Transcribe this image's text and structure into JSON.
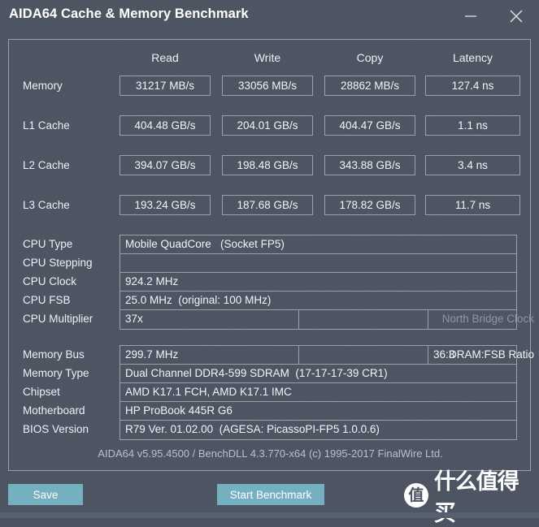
{
  "window": {
    "title": "AIDA64 Cache & Memory Benchmark",
    "minimize_label": "minimize",
    "close_label": "close"
  },
  "bench": {
    "columns": [
      "Read",
      "Write",
      "Copy",
      "Latency"
    ],
    "rows": [
      {
        "label": "Memory",
        "read": "31217 MB/s",
        "write": "33056 MB/s",
        "copy": "28862 MB/s",
        "latency": "127.4 ns"
      },
      {
        "label": "L1 Cache",
        "read": "404.48 GB/s",
        "write": "204.01 GB/s",
        "copy": "404.47 GB/s",
        "latency": "1.1 ns"
      },
      {
        "label": "L2 Cache",
        "read": "394.07 GB/s",
        "write": "198.48 GB/s",
        "copy": "343.88 GB/s",
        "latency": "3.4 ns"
      },
      {
        "label": "L3 Cache",
        "read": "193.24 GB/s",
        "write": "187.68 GB/s",
        "copy": "178.82 GB/s",
        "latency": "11.7 ns"
      }
    ]
  },
  "cpu_info": {
    "rows": [
      {
        "label": "CPU Type",
        "value": "Mobile QuadCore   (Socket FP5)"
      },
      {
        "label": "CPU Stepping",
        "value": ""
      },
      {
        "label": "CPU Clock",
        "value": "924.2 MHz"
      },
      {
        "label": "CPU FSB",
        "value": "25.0 MHz  (original: 100 MHz)"
      },
      {
        "label": "CPU Multiplier",
        "value": "37x",
        "mid_label": "North Bridge Clock",
        "mid_label_state": "disabled",
        "extra_value": ""
      }
    ]
  },
  "mem_info": {
    "rows": [
      {
        "label": "Memory Bus",
        "value": "299.7 MHz",
        "mid_label": "DRAM:FSB Ratio",
        "mid_label_state": "enabled",
        "extra_value": "36:3"
      },
      {
        "label": "Memory Type",
        "value": "Dual Channel DDR4-599 SDRAM  (17-17-17-39 CR1)"
      },
      {
        "label": "Chipset",
        "value": "AMD K17.1 FCH, AMD K17.1 IMC"
      },
      {
        "label": "Motherboard",
        "value": "HP ProBook 445R G6"
      },
      {
        "label": "BIOS Version",
        "value": "R79 Ver. 01.02.00  (AGESA: PicassoPI-FP5 1.0.0.6)"
      }
    ]
  },
  "footer": {
    "version_note": "AIDA64 v5.95.4500 / BenchDLL 4.3.770-x64  (c) 1995-2017 FinalWire Ltd."
  },
  "buttons": {
    "save": "Save",
    "start_benchmark": "Start Benchmark"
  },
  "watermark": {
    "logo_char": "值",
    "text": "什么值得买"
  },
  "colors": {
    "window_bg": "#4d5462",
    "accent": "#74b0bf",
    "border": "#9aa1ab",
    "text": "#f2f5f8",
    "text_dim": "#8f97a3"
  }
}
